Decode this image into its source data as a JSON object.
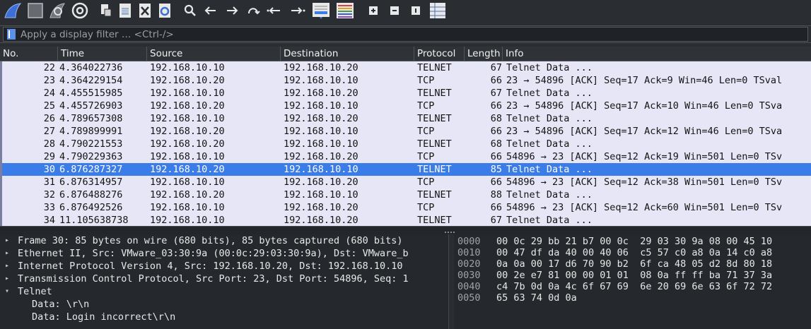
{
  "toolbar": {
    "icons": [
      "shark-fin-start-icon",
      "stop-icon",
      "restart-icon",
      "capture-options-icon",
      "open-file-icon",
      "save-file-icon",
      "close-file-icon",
      "reload-file-icon",
      "search-icon",
      "go-back-icon",
      "go-forward-icon",
      "go-to-packet-icon",
      "first-packet-icon",
      "last-packet-icon",
      "auto-scroll-icon",
      "colorize-icon",
      "zoom-in-icon",
      "zoom-out-icon",
      "normal-size-icon",
      "resize-columns-icon"
    ]
  },
  "filter": {
    "placeholder": "Apply a display filter … <Ctrl-/>"
  },
  "packet_list": {
    "columns": [
      "No.",
      "Time",
      "Source",
      "Destination",
      "Protocol",
      "Length",
      "Info"
    ],
    "rows": [
      {
        "no": "22",
        "time": "4.364022736",
        "src": "192.168.10.10",
        "dst": "192.168.10.20",
        "proto": "TELNET",
        "len": "67",
        "info": "Telnet Data ..."
      },
      {
        "no": "23",
        "time": "4.364229154",
        "src": "192.168.10.20",
        "dst": "192.168.10.10",
        "proto": "TCP",
        "len": "66",
        "info": "23 → 54896 [ACK] Seq=17 Ack=9 Win=46 Len=0 TSval"
      },
      {
        "no": "24",
        "time": "4.455515985",
        "src": "192.168.10.10",
        "dst": "192.168.10.20",
        "proto": "TELNET",
        "len": "67",
        "info": "Telnet Data ..."
      },
      {
        "no": "25",
        "time": "4.455726903",
        "src": "192.168.10.20",
        "dst": "192.168.10.10",
        "proto": "TCP",
        "len": "66",
        "info": "23 → 54896 [ACK] Seq=17 Ack=10 Win=46 Len=0 TSva"
      },
      {
        "no": "26",
        "time": "4.789657308",
        "src": "192.168.10.10",
        "dst": "192.168.10.20",
        "proto": "TELNET",
        "len": "68",
        "info": "Telnet Data ..."
      },
      {
        "no": "27",
        "time": "4.789899991",
        "src": "192.168.10.20",
        "dst": "192.168.10.10",
        "proto": "TCP",
        "len": "66",
        "info": "23 → 54896 [ACK] Seq=17 Ack=12 Win=46 Len=0 TSva"
      },
      {
        "no": "28",
        "time": "4.790221553",
        "src": "192.168.10.20",
        "dst": "192.168.10.10",
        "proto": "TELNET",
        "len": "68",
        "info": "Telnet Data ..."
      },
      {
        "no": "29",
        "time": "4.790229363",
        "src": "192.168.10.10",
        "dst": "192.168.10.20",
        "proto": "TCP",
        "len": "66",
        "info": "54896 → 23 [ACK] Seq=12 Ack=19 Win=501 Len=0 TSv"
      },
      {
        "no": "30",
        "time": "6.876287327",
        "src": "192.168.10.20",
        "dst": "192.168.10.10",
        "proto": "TELNET",
        "len": "85",
        "info": "Telnet Data ...",
        "selected": true
      },
      {
        "no": "31",
        "time": "6.876314957",
        "src": "192.168.10.10",
        "dst": "192.168.10.20",
        "proto": "TCP",
        "len": "66",
        "info": "54896 → 23 [ACK] Seq=12 Ack=38 Win=501 Len=0 TSv"
      },
      {
        "no": "32",
        "time": "6.876488276",
        "src": "192.168.10.20",
        "dst": "192.168.10.10",
        "proto": "TELNET",
        "len": "88",
        "info": "Telnet Data ..."
      },
      {
        "no": "33",
        "time": "6.876492526",
        "src": "192.168.10.10",
        "dst": "192.168.10.20",
        "proto": "TCP",
        "len": "66",
        "info": "54896 → 23 [ACK] Seq=12 Ack=60 Win=501 Len=0 TSv"
      },
      {
        "no": "34",
        "time": "11.105638738",
        "src": "192.168.10.10",
        "dst": "192.168.10.20",
        "proto": "TELNET",
        "len": "67",
        "info": "Telnet Data ..."
      }
    ]
  },
  "details": {
    "items": [
      {
        "text": "Frame 30: 85 bytes on wire (680 bits), 85 bytes captured (680 bits)",
        "arrow": "▸"
      },
      {
        "text": "Ethernet II, Src: VMware_03:30:9a (00:0c:29:03:30:9a), Dst: VMware_b",
        "arrow": "▸"
      },
      {
        "text": "Internet Protocol Version 4, Src: 192.168.10.20, Dst: 192.168.10.10",
        "arrow": "▸"
      },
      {
        "text": "Transmission Control Protocol, Src Port: 23, Dst Port: 54896, Seq: 1",
        "arrow": "▸"
      },
      {
        "text": "Telnet",
        "arrow": "▾"
      }
    ],
    "sub_items": [
      "Data: \\r\\n",
      "Data: Login incorrect\\r\\n"
    ]
  },
  "bytes": {
    "rows": [
      {
        "offset": "0000",
        "hex": "00 0c 29 bb 21 b7 00 0c  29 03 30 9a 08 00 45 10"
      },
      {
        "offset": "0010",
        "hex": "00 47 df da 40 00 40 06  c5 57 c0 a8 0a 14 c0 a8"
      },
      {
        "offset": "0020",
        "hex": "0a 0a 00 17 d6 70 90 b2  6f ca 48 05 d2 8d 80 18"
      },
      {
        "offset": "0030",
        "hex": "00 2e e7 81 00 00 01 01  08 0a ff ff ba 71 37 3a"
      },
      {
        "offset": "0040",
        "hex": "c4 7b 0d 0a 4c 6f 67 69  6e 20 69 6e 63 6f 72 72"
      },
      {
        "offset": "0050",
        "hex": "65 63 74 0d 0a"
      }
    ]
  },
  "colors": {
    "row_bg": "#e6e6f6",
    "selected_bg": "#3b7de8",
    "pane_bg": "#25292d",
    "toolbar_bg": "#2a2e33"
  }
}
